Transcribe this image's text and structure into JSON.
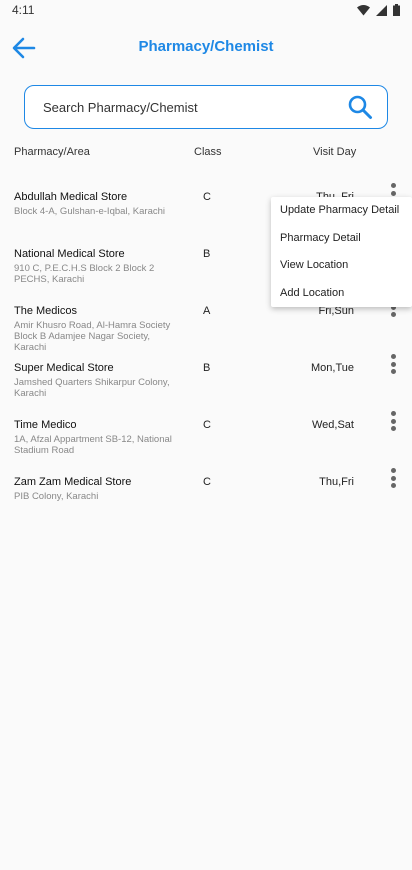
{
  "status": {
    "time": "4:11"
  },
  "header": {
    "title": "Pharmacy/Chemist"
  },
  "search": {
    "placeholder": "Search Pharmacy/Chemist"
  },
  "columns": {
    "area": "Pharmacy/Area",
    "class": "Class",
    "visit": "Visit Day"
  },
  "rows": [
    {
      "name": "Abdullah Medical Store",
      "address": "Block 4-A, Gulshan-e-Iqbal, Karachi",
      "class": "C",
      "visit": "Thu, Fri"
    },
    {
      "name": "National Medical Store",
      "address": "910 C, P.E.C.H.S Block 2 Block 2 PECHS, Karachi",
      "class": "B",
      "visit": ""
    },
    {
      "name": "The Medicos",
      "address": "Amir Khusro Road, Al-Hamra Society Block B Adamjee Nagar Society, Karachi",
      "class": "A",
      "visit": "Fri,Sun"
    },
    {
      "name": "Super Medical Store",
      "address": "Jamshed Quarters Shikarpur Colony, Karachi",
      "class": "B",
      "visit": "Mon,Tue"
    },
    {
      "name": "Time Medico",
      "address": "1A, Afzal Appartment SB-12, National Stadium Road",
      "class": "C",
      "visit": "Wed,Sat"
    },
    {
      "name": "Zam Zam Medical Store",
      "address": "PIB Colony, Karachi",
      "class": "C",
      "visit": "Thu,Fri"
    }
  ],
  "menu": {
    "update": "Update Pharmacy Detail",
    "detail": "Pharmacy Detail",
    "location": "View Location",
    "add": "Add Location"
  },
  "colors": {
    "accent": "#1e88e5"
  }
}
